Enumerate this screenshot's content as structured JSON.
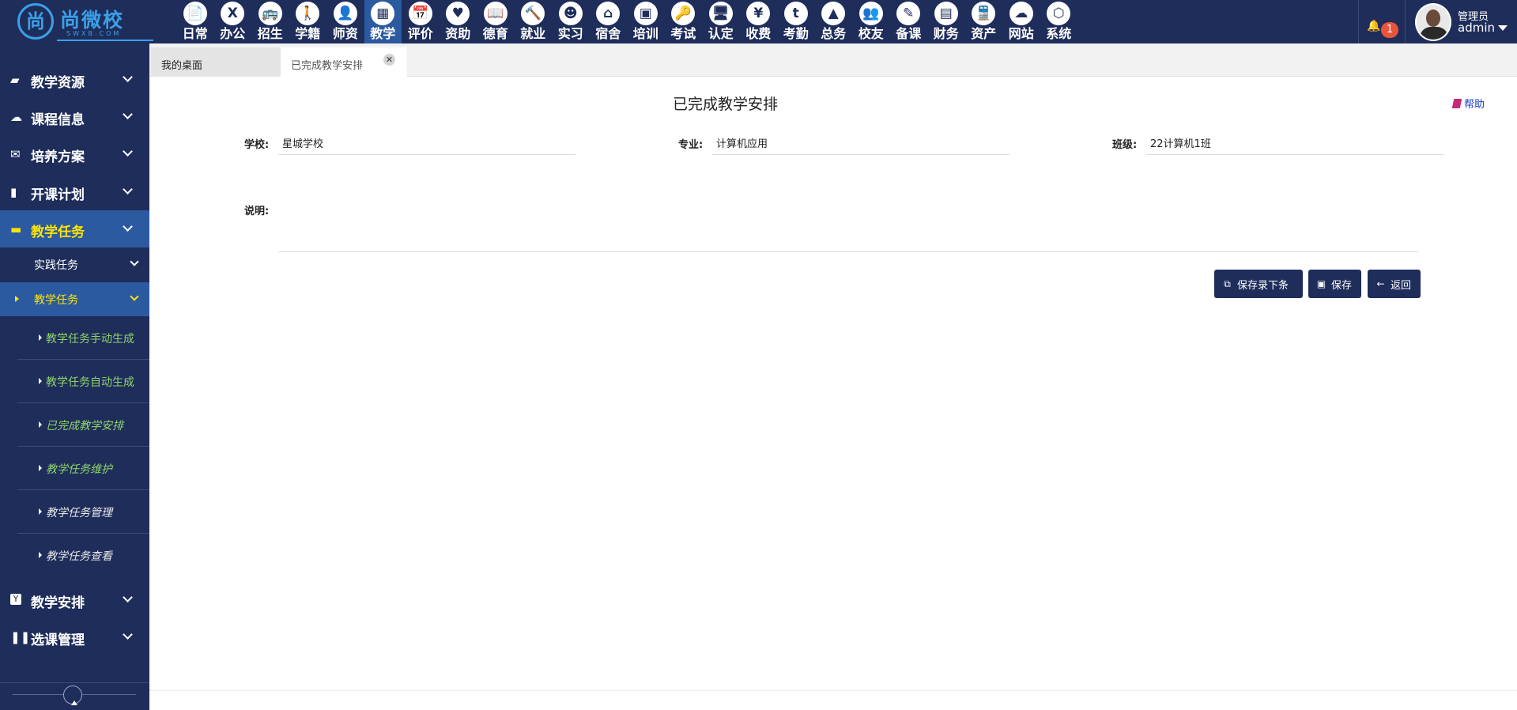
{
  "brand": {
    "name": "尚微校",
    "sub": "SWXB.COM"
  },
  "topnav": [
    {
      "label": "日常",
      "icon": "document-icon",
      "glyph": "📄"
    },
    {
      "label": "办公",
      "icon": "xing-icon",
      "glyph": "X"
    },
    {
      "label": "招生",
      "icon": "bus-icon",
      "glyph": "🚌"
    },
    {
      "label": "学籍",
      "icon": "person-icon",
      "glyph": "🚶"
    },
    {
      "label": "师资",
      "icon": "teacher-icon",
      "glyph": "👤"
    },
    {
      "label": "教学",
      "icon": "calendar-icon",
      "glyph": "▦"
    },
    {
      "label": "评价",
      "icon": "calendar-plus-icon",
      "glyph": "📅"
    },
    {
      "label": "资助",
      "icon": "charity-icon",
      "glyph": "♥"
    },
    {
      "label": "德育",
      "icon": "book-icon",
      "glyph": "📖"
    },
    {
      "label": "就业",
      "icon": "gavel-icon",
      "glyph": "🔨"
    },
    {
      "label": "实习",
      "icon": "robot-icon",
      "glyph": "☻"
    },
    {
      "label": "宿舍",
      "icon": "home-icon",
      "glyph": "⌂"
    },
    {
      "label": "培训",
      "icon": "image-icon",
      "glyph": "▣"
    },
    {
      "label": "考试",
      "icon": "key-icon",
      "glyph": "🔑"
    },
    {
      "label": "认定",
      "icon": "monitor-icon",
      "glyph": "🖥"
    },
    {
      "label": "收费",
      "icon": "yen-icon",
      "glyph": "¥"
    },
    {
      "label": "考勤",
      "icon": "tumblr-icon",
      "glyph": "t"
    },
    {
      "label": "总务",
      "icon": "chart-area-icon",
      "glyph": "▲"
    },
    {
      "label": "校友",
      "icon": "users-icon",
      "glyph": "👥"
    },
    {
      "label": "备课",
      "icon": "edit-icon",
      "glyph": "✎"
    },
    {
      "label": "财务",
      "icon": "newspaper-icon",
      "glyph": "▤"
    },
    {
      "label": "资产",
      "icon": "train-icon",
      "glyph": "🚆"
    },
    {
      "label": "网站",
      "icon": "cloud-icon",
      "glyph": "☁"
    },
    {
      "label": "系统",
      "icon": "cube-icon",
      "glyph": "⬡"
    }
  ],
  "active_nav": "教学",
  "notifications": {
    "count": "1",
    "icon": "bell-icon"
  },
  "user": {
    "role": "管理员",
    "name": "admin"
  },
  "sidebar": {
    "groups": [
      {
        "label": "教学资源",
        "icon": "book-icon",
        "glyph": "📘"
      },
      {
        "label": "课程信息",
        "icon": "cloud-icon",
        "glyph": "☁"
      },
      {
        "label": "培养方案",
        "icon": "envelope-icon",
        "glyph": "✉"
      },
      {
        "label": "开课计划",
        "icon": "file-icon",
        "glyph": "📄"
      },
      {
        "label": "教学任务",
        "icon": "folder-icon",
        "glyph": "📁"
      },
      {
        "label": "教学安排",
        "icon": "y-combinator-icon",
        "glyph": "Y"
      },
      {
        "label": "选课管理",
        "icon": "pause-icon",
        "glyph": "❚❚"
      }
    ],
    "sub": [
      {
        "label": "实践任务"
      },
      {
        "label": "教学任务"
      }
    ],
    "leaves": [
      {
        "label": "教学任务手动生成"
      },
      {
        "label": "教学任务自动生成"
      },
      {
        "label": "已完成教学安排"
      },
      {
        "label": "教学任务维护"
      },
      {
        "label": "教学任务管理"
      },
      {
        "label": "教学任务查看"
      }
    ]
  },
  "tabs": {
    "home": "我的桌面",
    "current": "已完成教学安排",
    "close_glyph": "✕"
  },
  "page": {
    "title": "已完成教学安排",
    "help": "帮助"
  },
  "form": {
    "school_label": "学校:",
    "school_value": "星城学校",
    "major_label": "专业:",
    "major_value": "计算机应用",
    "class_label": "班级:",
    "class_value": "22计算机1班",
    "remark_label": "说明:",
    "remark_value": ""
  },
  "buttons": {
    "save_next": "保存录下条",
    "save": "保存",
    "back": "返回"
  },
  "colors": {
    "primary": "#1f2d5b",
    "active": "#2c5aa0",
    "highlight": "#ffe400",
    "leaf_green": "#8fd46a",
    "badge": "#e8543c",
    "help_link": "#1a3cc8"
  }
}
